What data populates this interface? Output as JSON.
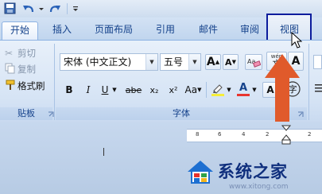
{
  "tabs": [
    {
      "label": "开始"
    },
    {
      "label": "插入"
    },
    {
      "label": "页面布局"
    },
    {
      "label": "引用"
    },
    {
      "label": "邮件"
    },
    {
      "label": "审阅"
    },
    {
      "label": "视图"
    }
  ],
  "clipboard": {
    "cut_label": "剪切",
    "copy_label": "复制",
    "format_painter_label": "格式刷",
    "group_label": "贴板"
  },
  "font": {
    "font_name": "宋体 (中文正文)",
    "font_size": "五号",
    "grow_label": "A",
    "shrink_label": "A",
    "bold": "B",
    "italic": "I",
    "underline": "U",
    "strike": "abe",
    "subscript": "x₂",
    "superscript": "x²",
    "change_case": "Aa",
    "font_color_letter": "A",
    "highlight_letter": "A",
    "encircle": "字",
    "pinyin_label": "wén",
    "group_label": "字体"
  },
  "ruler": {
    "ticks": [
      "8",
      "6",
      "4",
      "2",
      "2"
    ]
  },
  "watermark": {
    "text": "系统之家",
    "url": "www.xitong.com"
  },
  "colors": {
    "highlight_box": "#0b1c9c",
    "arrow": "#e05a2b",
    "font_color_bar": "#e8352f",
    "highlight_bar": "#f6ee3a"
  }
}
